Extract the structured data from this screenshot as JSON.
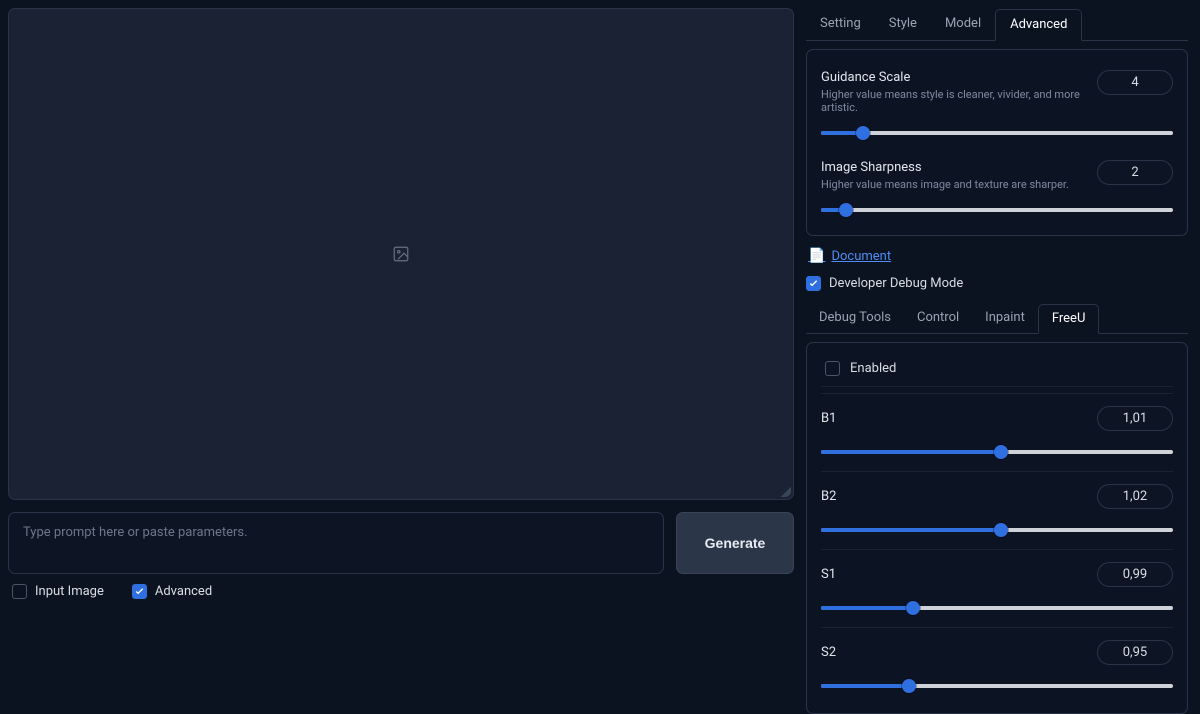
{
  "left": {
    "prompt_placeholder": "Type prompt here or paste parameters.",
    "generate_label": "Generate",
    "checks": {
      "input_image": {
        "label": "Input Image",
        "checked": false
      },
      "advanced": {
        "label": "Advanced",
        "checked": true
      }
    }
  },
  "tabs": {
    "items": [
      "Setting",
      "Style",
      "Model",
      "Advanced"
    ],
    "active": 3
  },
  "advanced": {
    "guidance": {
      "title": "Guidance Scale",
      "desc": "Higher value means style is cleaner, vivider, and more artistic.",
      "value": "4",
      "pct": 12
    },
    "sharpness": {
      "title": "Image Sharpness",
      "desc": "Higher value means image and texture are sharper.",
      "value": "2",
      "pct": 7
    }
  },
  "document_link": "Document",
  "debug_mode": {
    "label": "Developer Debug Mode",
    "checked": true
  },
  "sub_tabs": {
    "items": [
      "Debug Tools",
      "Control",
      "Inpaint",
      "FreeU"
    ],
    "active": 3
  },
  "freeu": {
    "enabled": {
      "label": "Enabled",
      "checked": false
    },
    "b1": {
      "label": "B1",
      "value": "1,01",
      "pct": 51
    },
    "b2": {
      "label": "B2",
      "value": "1,02",
      "pct": 51
    },
    "s1": {
      "label": "S1",
      "value": "0,99",
      "pct": 26
    },
    "s2": {
      "label": "S2",
      "value": "0,95",
      "pct": 25
    }
  }
}
